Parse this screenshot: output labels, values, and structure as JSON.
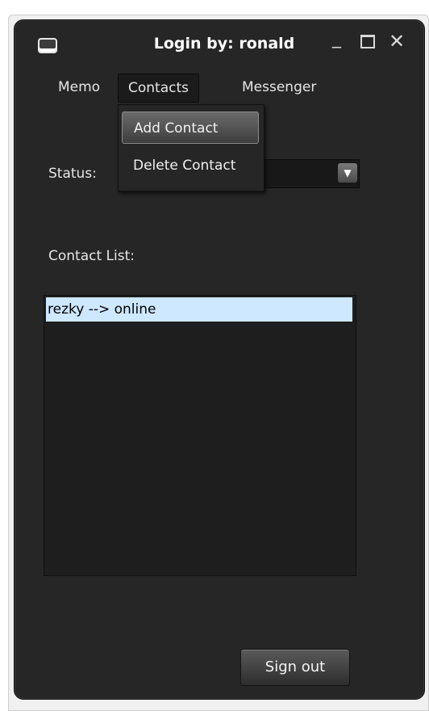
{
  "window": {
    "title": "Login by: ronald",
    "icon": "window-app-icon",
    "controls": {
      "minimize": "_",
      "maximize": "box",
      "close": "✕"
    }
  },
  "menu": {
    "items": [
      "Memo",
      "Contacts",
      "Messenger"
    ],
    "active": "Contacts"
  },
  "dropdown": {
    "items": [
      "Add Contact",
      "Delete Contact"
    ],
    "highlighted": "Add Contact"
  },
  "status": {
    "label": "Status:",
    "value": ""
  },
  "contacts": {
    "label": "Contact List:",
    "rows": [
      "rezky --> online"
    ],
    "selected_color": "#cde8ff"
  },
  "actions": {
    "sign_out": "Sign out"
  }
}
